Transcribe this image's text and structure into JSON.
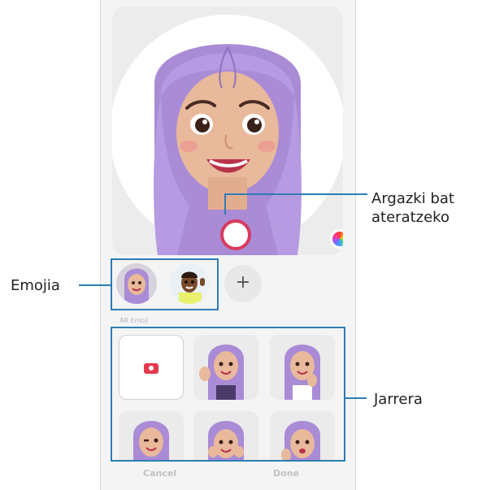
{
  "camera_ui": {
    "preview_alt": "AR emoji preview",
    "capture_button_label": "",
    "add_label": "+",
    "section_label": "AR Emoji",
    "cancel_label": "Cancel",
    "done_label": "Done"
  },
  "callouts": {
    "capture": [
      "Argazki bat",
      "ateratzeko"
    ],
    "emoji": "Emojia",
    "pose": "Jarrera"
  },
  "colors": {
    "accent": "#2f7db4",
    "hair": "#a98bd6",
    "capture_ring": "#d93a5e",
    "record_icon": "#e53a4d"
  },
  "icons": [
    "palette-icon",
    "plus-icon",
    "camera-icon"
  ]
}
